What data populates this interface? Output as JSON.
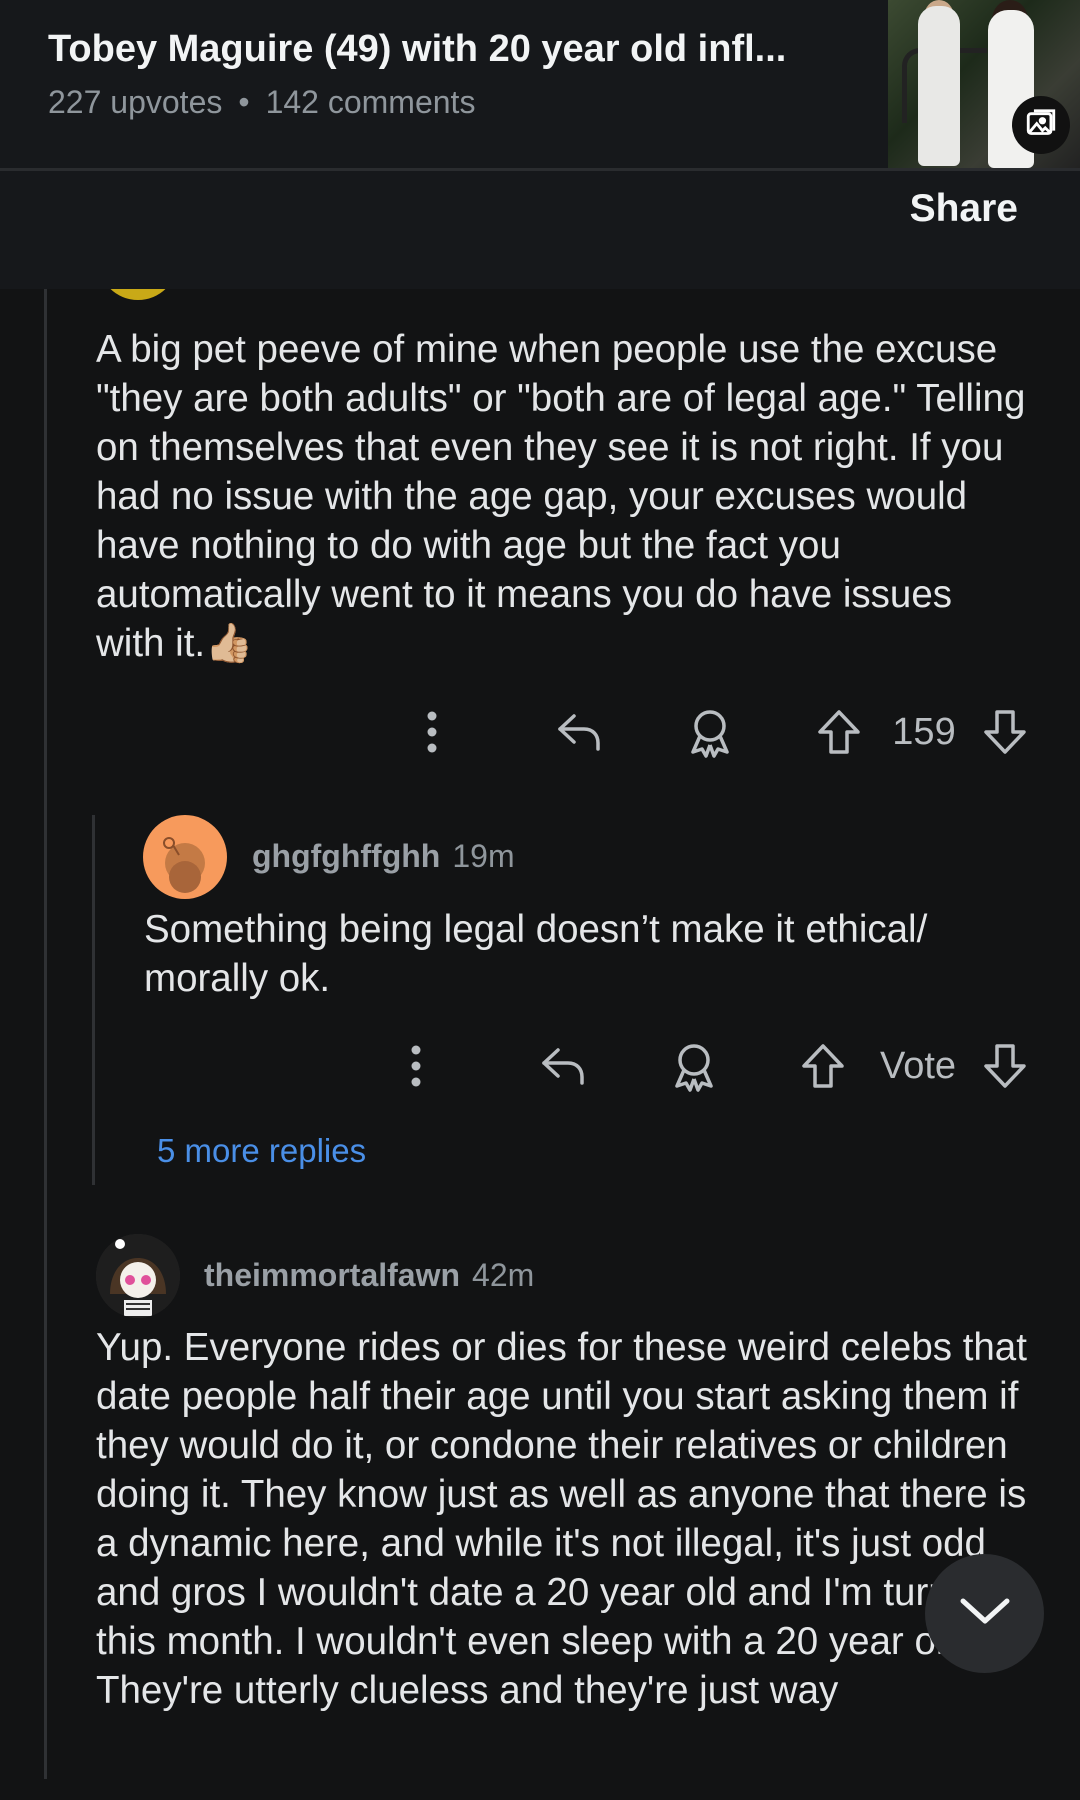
{
  "post": {
    "title": "Tobey Maguire (49) with 20 year old infl...",
    "upvotes": "227 upvotes",
    "separator": "•",
    "comments": "142 comments"
  },
  "toolbar": {
    "share_label": "Share"
  },
  "comments": [
    {
      "text": "A big pet peeve of mine when people use the excuse \"they are both adults\" or \"both are of legal age.\" Telling on themselves that even they see it is not right. If you had no issue with the age gap, your excuses would have nothing to do with age but the fact you automatically went to it means you do have issues with it.👍🏼",
      "score": "159"
    },
    {
      "author": "ghgfghffghh",
      "time": "19m",
      "text": "Something being legal doesn’t make it ethical/ morally ok.",
      "score": "Vote",
      "more_replies": "5 more replies"
    },
    {
      "author": "theimmortalfawn",
      "time": "42m",
      "text": "Yup. Everyone rides or dies for these weird celebs that date people half their age until you start asking them if they would do it, or condone their relatives or children doing it. They know just as well as anyone that there is a dynamic here, and while it's not illegal, it's just odd and gros I wouldn't date a 20 year old and I'm turning 2 this month. I wouldn't even sleep with a 20 year old. They're utterly clueless and they're just way"
    }
  ],
  "icons": {
    "more": "more-vertical-icon",
    "reply": "reply-icon",
    "award": "award-icon",
    "upvote": "upvote-arrow-icon",
    "downvote": "downvote-arrow-icon",
    "image": "image-icon",
    "scroll_down": "chevron-down-icon"
  },
  "colors": {
    "background": "#121314",
    "header": "#16181b",
    "link": "#4a8fe7",
    "avatar_orange": "#f79a5c"
  }
}
